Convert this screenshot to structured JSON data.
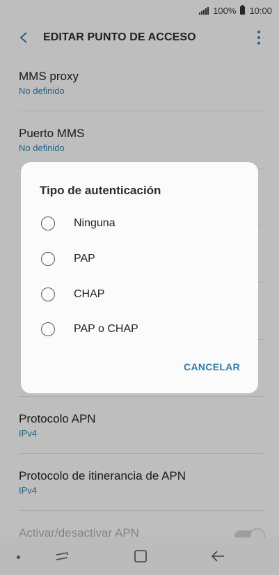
{
  "status": {
    "battery_percent": "100%",
    "time": "10:00"
  },
  "header": {
    "title": "EDITAR PUNTO DE ACCESO"
  },
  "list": {
    "items": [
      {
        "title": "MMS proxy",
        "value": "No definido"
      },
      {
        "title": "Puerto MMS",
        "value": "No definido"
      },
      {
        "title": "",
        "value": ""
      },
      {
        "title": "",
        "value": ""
      },
      {
        "title": "",
        "value": ""
      },
      {
        "title": "",
        "value": ""
      },
      {
        "title": "Protocolo APN",
        "value": "IPv4"
      },
      {
        "title": "Protocolo de itinerancia de APN",
        "value": "IPv4"
      },
      {
        "title": "Activar/desactivar APN",
        "value": ""
      }
    ]
  },
  "dialog": {
    "title": "Tipo de autenticación",
    "options": [
      {
        "label": "Ninguna"
      },
      {
        "label": "PAP"
      },
      {
        "label": "CHAP"
      },
      {
        "label": "PAP o CHAP"
      }
    ],
    "cancel_label": "CANCELAR"
  },
  "colors": {
    "accent": "#2e7da8"
  }
}
